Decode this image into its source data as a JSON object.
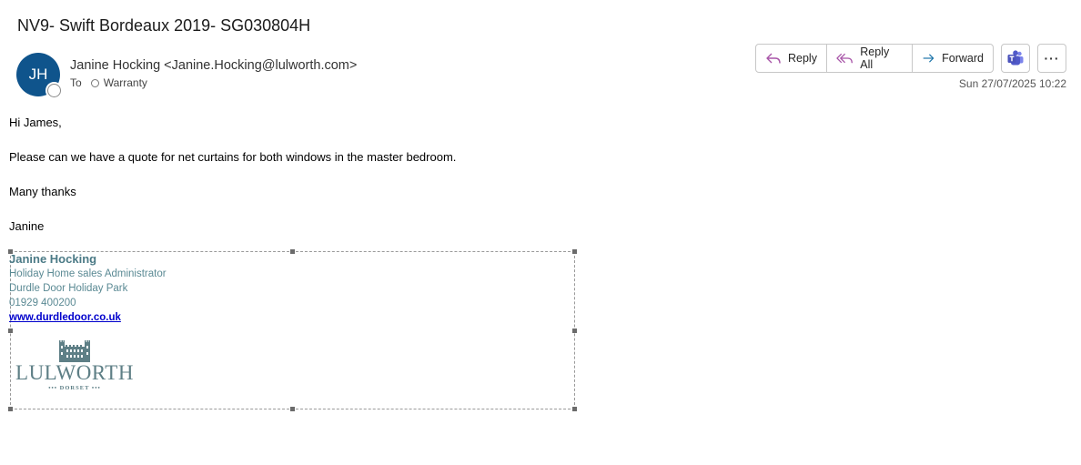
{
  "email": {
    "subject": "NV9- Swift Bordeaux 2019- SG030804H",
    "sender": {
      "initials": "JH",
      "display": "Janine Hocking <Janine.Hocking@lulworth.com>"
    },
    "to_label": "To",
    "recipient": "Warranty",
    "datetime": "Sun 27/07/2025 10:22"
  },
  "actions": {
    "reply": "Reply",
    "reply_all": "Reply All",
    "forward": "Forward"
  },
  "body": {
    "greeting": "Hi James,",
    "message": "Please can we have a quote for net curtains for both windows in the master bedroom.",
    "closing": "Many thanks",
    "sign_off": "Janine"
  },
  "signature": {
    "name": "Janine Hocking",
    "title": "Holiday Home sales Administrator",
    "park": "Durdle Door Holiday Park",
    "phone": "01929 400200",
    "website": "www.durdledoor.co.uk",
    "logo_text": "LULWORTH",
    "logo_subtext": "••• DORSET •••"
  },
  "colors": {
    "avatar": "#0f548c",
    "signature_text": "#5b8a94",
    "link": "#0000cc",
    "reply_icon": "#a855a8",
    "forward_icon": "#1a73a8",
    "teams_icon": "#5059c9"
  },
  "icons": [
    "reply-icon",
    "reply-all-icon",
    "forward-icon",
    "teams-icon",
    "more-icon"
  ]
}
